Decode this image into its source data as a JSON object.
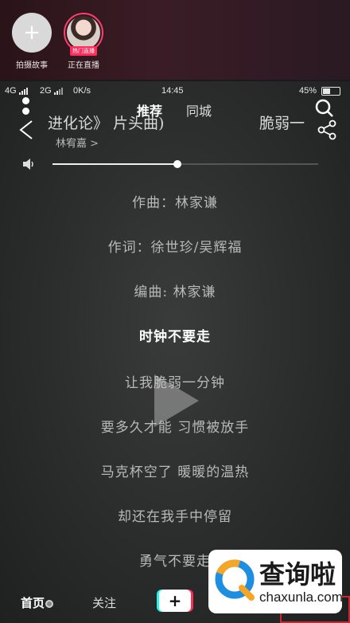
{
  "stories": [
    {
      "caption": "拍摄故事",
      "icon": "plus-icon"
    },
    {
      "caption": "正在直播",
      "tag": "热门直播",
      "icon": "avatar"
    }
  ],
  "status_bar": {
    "carrier1": "4G",
    "carrier2": "2G",
    "speed": "0K/s",
    "time": "14:45",
    "battery": "45%"
  },
  "feed_tabs": {
    "recommend": "推荐",
    "local": "同城"
  },
  "song": {
    "title": "进化论》 片头曲)",
    "artist": "林宥嘉 >",
    "right_title": "脆弱一"
  },
  "volume": {
    "level": 0.47
  },
  "lyrics": [
    {
      "text": "作曲：林家谦",
      "current": false
    },
    {
      "text": "作词：徐世珍/吴辉福",
      "current": false
    },
    {
      "text": "编曲: 林家谦",
      "current": false
    },
    {
      "text": "时钟不要走",
      "current": true
    },
    {
      "text": "让我脆弱一分钟",
      "current": false
    },
    {
      "text": "要多久才能 习惯被放手",
      "current": false
    },
    {
      "text": "马克杯空了 暖暖的温热",
      "current": false
    },
    {
      "text": "却还在我手中停留",
      "current": false
    },
    {
      "text": "勇气不要走",
      "current": false
    }
  ],
  "bottom_nav": {
    "home": "首页",
    "follow": "关注",
    "create": "+"
  },
  "watermark": {
    "title": "查询啦",
    "url": "chaxunla.com"
  },
  "colors": {
    "accent_pink": "#ff2d5e",
    "highlight_red": "#c8282e"
  }
}
